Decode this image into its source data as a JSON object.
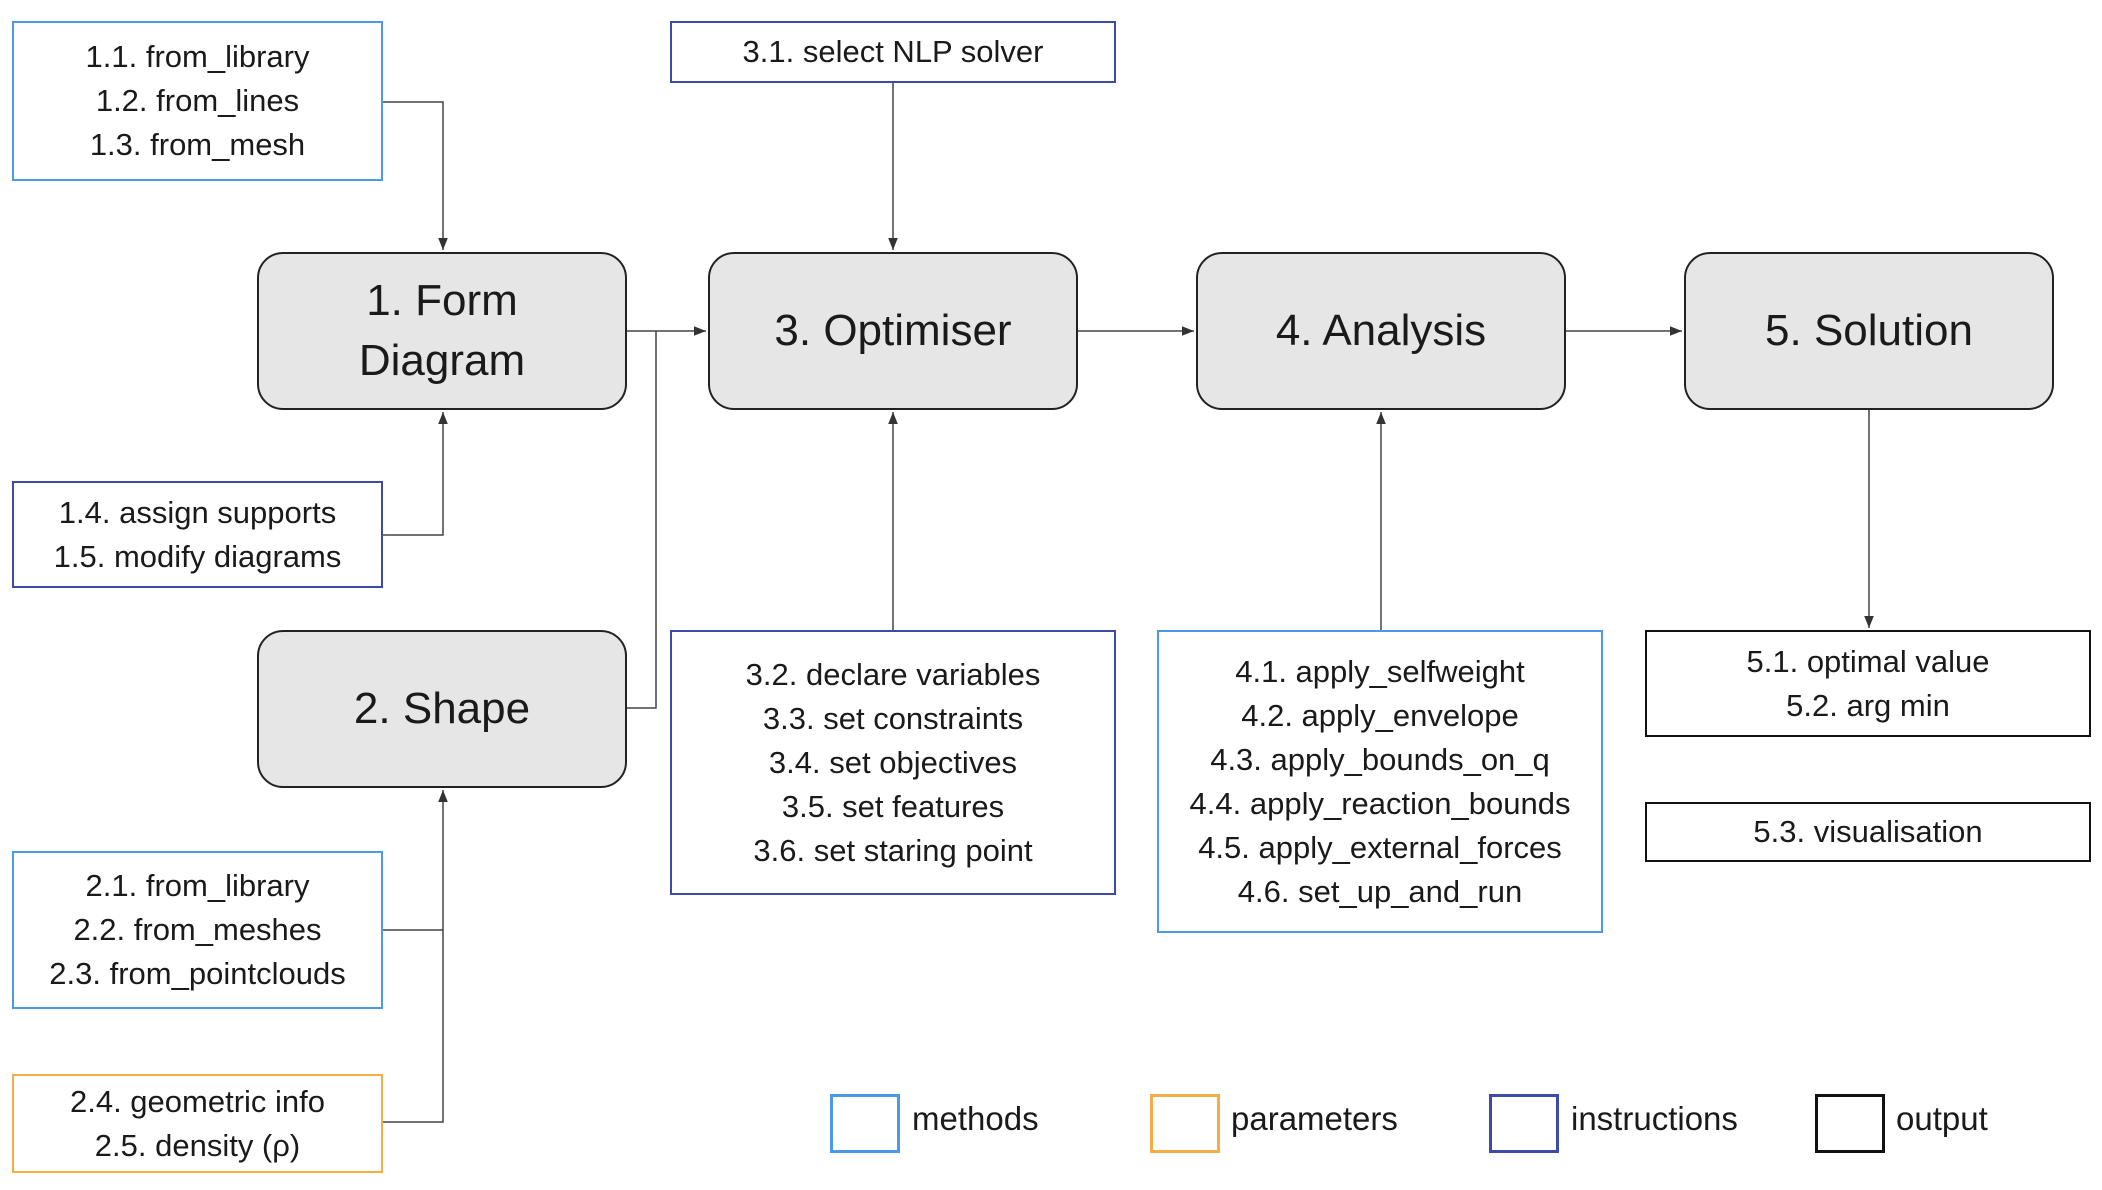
{
  "nodes": {
    "form_diagram": [
      "1. Form",
      "Diagram"
    ],
    "shape": "2. Shape",
    "optimiser": "3. Optimiser",
    "analysis": "4. Analysis",
    "solution": "5. Solution"
  },
  "boxes": {
    "form_methods": [
      "1.1. from_library",
      "1.2. from_lines",
      "1.3. from_mesh"
    ],
    "form_instructions": [
      "1.4. assign supports",
      "1.5. modify diagrams"
    ],
    "shape_methods": [
      "2.1. from_library",
      "2.2. from_meshes",
      "2.3. from_pointclouds"
    ],
    "shape_parameters": [
      "2.4. geometric info",
      "2.5. density (ρ)"
    ],
    "solver": [
      "3.1. select NLP solver"
    ],
    "optimiser_instructions": [
      "3.2. declare variables",
      "3.3. set constraints",
      "3.4. set objectives",
      "3.5. set features",
      "3.6. set staring point"
    ],
    "analysis_methods": [
      "4.1. apply_selfweight",
      "4.2. apply_envelope",
      "4.3. apply_bounds_on_q",
      "4.4. apply_reaction_bounds",
      "4.5. apply_external_forces",
      "4.6. set_up_and_run"
    ],
    "solution_output": [
      "5.1. optimal value",
      "5.2. arg min"
    ],
    "visualisation": [
      "5.3. visualisation"
    ]
  },
  "legend": {
    "methods": {
      "label": "methods",
      "color": "#4a9ae8"
    },
    "parameters": {
      "label": "parameters",
      "color": "#f4ae45"
    },
    "instructions": {
      "label": "instructions",
      "color": "#3d4aa8"
    },
    "output": {
      "label": "output",
      "color": "#111111"
    }
  }
}
